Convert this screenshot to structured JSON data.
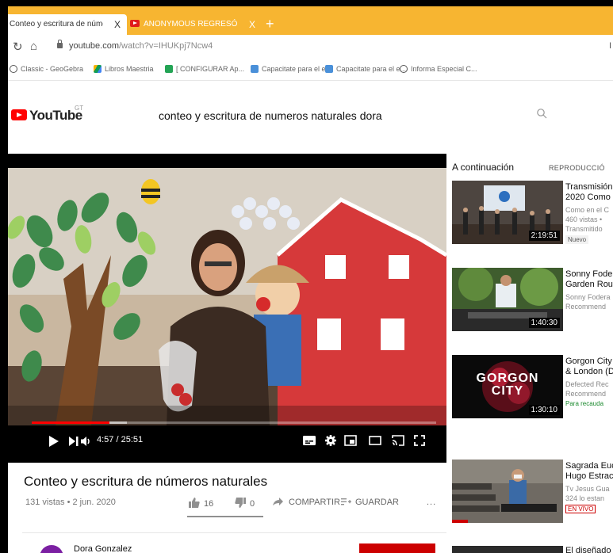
{
  "browser": {
    "tabs": [
      {
        "title": "Conteo y escritura de núme",
        "close": "X"
      },
      {
        "title": "ANONYMOUS REGRESÓ, SU ME",
        "close": "X"
      }
    ],
    "new_tab": "+",
    "url_host": "youtube.com",
    "url_path": "/watch?v=IHUKpj7Ncw4",
    "corner": "I",
    "bookmarks": [
      {
        "label": "Classic - GeoGebra",
        "icon": "geogebra-icon",
        "color": "#666666"
      },
      {
        "label": "Libros Maestria",
        "icon": "drive-icon",
        "color": "#1a9c4a"
      },
      {
        "label": "[ CONFIGURAR Ap...",
        "icon": "app-icon",
        "color": "#23a455"
      },
      {
        "label": "Capacitate para el e...",
        "icon": "doc-icon",
        "color": "#4a90d9"
      },
      {
        "label": "Capacitate para el e...",
        "icon": "doc-icon",
        "color": "#4a90d9"
      },
      {
        "label": "Informa Especial C...",
        "icon": "globe-icon",
        "color": "#555555"
      }
    ]
  },
  "youtube": {
    "logo": "YouTube",
    "country": "GT",
    "search_query": "conteo y escritura de numeros naturales dora"
  },
  "player": {
    "time": "4:57 / 25:51",
    "progress": 0.192,
    "buffered": 0.235
  },
  "video": {
    "title": "Conteo y escritura de números naturales",
    "views": "131 vistas • 2 jun. 2020",
    "likes": "16",
    "dislikes": "0",
    "share": "COMPARTIR",
    "save": "GUARDAR",
    "more": "...",
    "like_ratio": 1.0,
    "channel": "Dora Gonzalez",
    "avatar_letter": "D"
  },
  "sidebar": {
    "up_next": "A continuación",
    "autoplay": "REPRODUCCIÓ",
    "items": [
      {
        "title": "Transmisión",
        "title2": "2020 Como",
        "line1": "Como en el C",
        "line2": "460 vistas •",
        "line3": "Transmitido",
        "badge": "Nuevo",
        "duration": "2:19:51"
      },
      {
        "title": "Sonny Fode",
        "title2": "Garden Rou",
        "line1": "Sonny Fodera",
        "line2": "Recommend",
        "duration": "1:40:30"
      },
      {
        "title": "Gorgon City",
        "title2": "& London (D",
        "line1": "Defected Rec",
        "line2": "Recommend",
        "green": "Para recauda",
        "thumb_text_1": "GORGON",
        "thumb_text_2": "CITY",
        "duration": "1:30:10"
      },
      {
        "title": "Sagrada Euc",
        "title2": "Hugo Estrac",
        "line1": "Tv Jesus Gua",
        "line2": "324 lo estan",
        "live": "EN VIVO"
      }
    ],
    "last_title": "El diseñado"
  }
}
